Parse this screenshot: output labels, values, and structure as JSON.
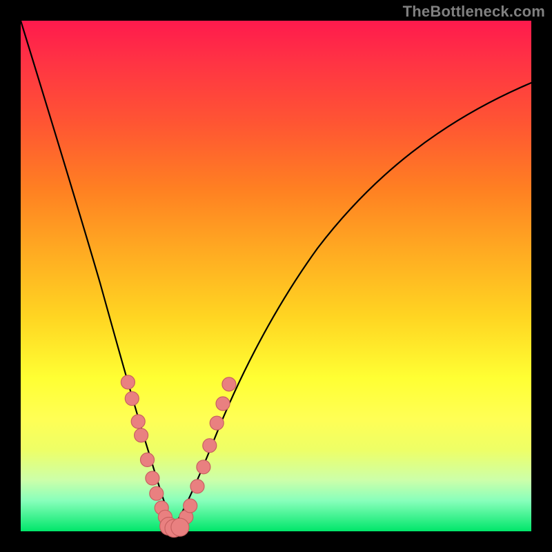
{
  "watermark": "TheBottleneck.com",
  "chart_data": {
    "type": "line",
    "title": "",
    "xlabel": "",
    "ylabel": "",
    "xlim": [
      0,
      1
    ],
    "ylim": [
      0,
      1
    ],
    "note": "No axis tick labels are visible; x and y are normalized 0–1 estimates from the image. y≈1 at top (red), y≈0 at bottom (green).",
    "series": [
      {
        "name": "left-curve",
        "x": [
          0.0,
          0.04,
          0.08,
          0.12,
          0.16,
          0.2,
          0.24,
          0.27,
          0.29
        ],
        "y": [
          1.0,
          0.82,
          0.63,
          0.46,
          0.31,
          0.18,
          0.08,
          0.02,
          0.0
        ]
      },
      {
        "name": "right-curve",
        "x": [
          0.29,
          0.32,
          0.36,
          0.42,
          0.5,
          0.6,
          0.72,
          0.85,
          1.0
        ],
        "y": [
          0.0,
          0.04,
          0.12,
          0.24,
          0.4,
          0.56,
          0.7,
          0.8,
          0.88
        ]
      }
    ],
    "markers": {
      "name": "salmon-dots",
      "points": [
        {
          "x": 0.21,
          "y": 0.292
        },
        {
          "x": 0.218,
          "y": 0.26
        },
        {
          "x": 0.23,
          "y": 0.215
        },
        {
          "x": 0.236,
          "y": 0.188
        },
        {
          "x": 0.248,
          "y": 0.14
        },
        {
          "x": 0.258,
          "y": 0.104
        },
        {
          "x": 0.266,
          "y": 0.074
        },
        {
          "x": 0.276,
          "y": 0.046
        },
        {
          "x": 0.283,
          "y": 0.028
        },
        {
          "x": 0.29,
          "y": 0.014
        },
        {
          "x": 0.3,
          "y": 0.006
        },
        {
          "x": 0.312,
          "y": 0.01
        },
        {
          "x": 0.324,
          "y": 0.028
        },
        {
          "x": 0.332,
          "y": 0.05
        },
        {
          "x": 0.346,
          "y": 0.088
        },
        {
          "x": 0.358,
          "y": 0.126
        },
        {
          "x": 0.37,
          "y": 0.168
        },
        {
          "x": 0.384,
          "y": 0.212
        },
        {
          "x": 0.396,
          "y": 0.25
        },
        {
          "x": 0.408,
          "y": 0.288
        }
      ],
      "bottom_blob": [
        {
          "x": 0.29,
          "y": 0.01
        },
        {
          "x": 0.3,
          "y": 0.006
        },
        {
          "x": 0.312,
          "y": 0.008
        }
      ]
    },
    "gradient_stops": [
      {
        "pos": 0.0,
        "color": "#ff1a4d"
      },
      {
        "pos": 0.2,
        "color": "#ff5533"
      },
      {
        "pos": 0.45,
        "color": "#ffaa22"
      },
      {
        "pos": 0.7,
        "color": "#ffff33"
      },
      {
        "pos": 0.9,
        "color": "#ccffaa"
      },
      {
        "pos": 1.0,
        "color": "#00e66a"
      }
    ]
  }
}
